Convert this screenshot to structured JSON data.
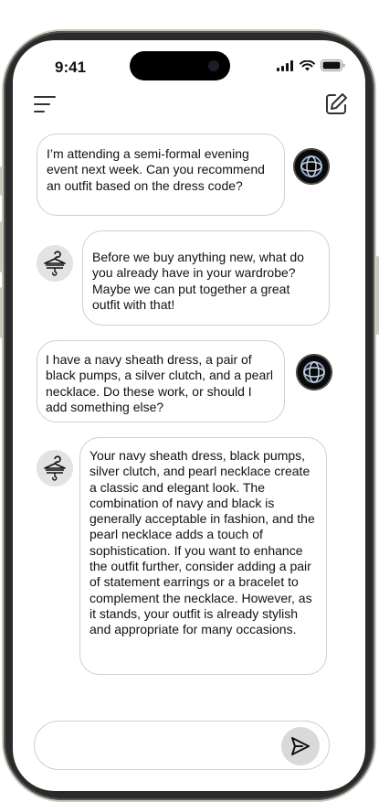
{
  "status_bar": {
    "time": "9:41"
  },
  "header": {
    "menu_icon": "hamburger-menu-icon",
    "edit_icon": "edit-compose-icon"
  },
  "messages": [
    {
      "sender": "user",
      "text": "I’m attending a semi-formal evening event next week. Can you recommend an outfit based on the dress code?"
    },
    {
      "sender": "assistant",
      "text": "Before we buy anything new, what do you already have in your wardrobe? Maybe we can put together a great outfit with that!"
    },
    {
      "sender": "user",
      "text": "I have a navy sheath dress, a pair of black pumps, a silver clutch, and a pearl necklace. Do these work, or should I add something else?"
    },
    {
      "sender": "assistant",
      "text": "Your navy sheath dress, black pumps, silver clutch, and pearl necklace create a classic and elegant look. The combination of navy and black is generally acceptable in fashion, and the pearl necklace adds a touch of sophistication. If you want to enhance the outfit further, consider adding a pair of statement earrings or a bracelet to complement the necklace. However, as it stands, your outfit is already stylish and appropriate for many occasions."
    }
  ],
  "composer": {
    "placeholder": "",
    "value": "",
    "send_icon": "send-icon"
  }
}
